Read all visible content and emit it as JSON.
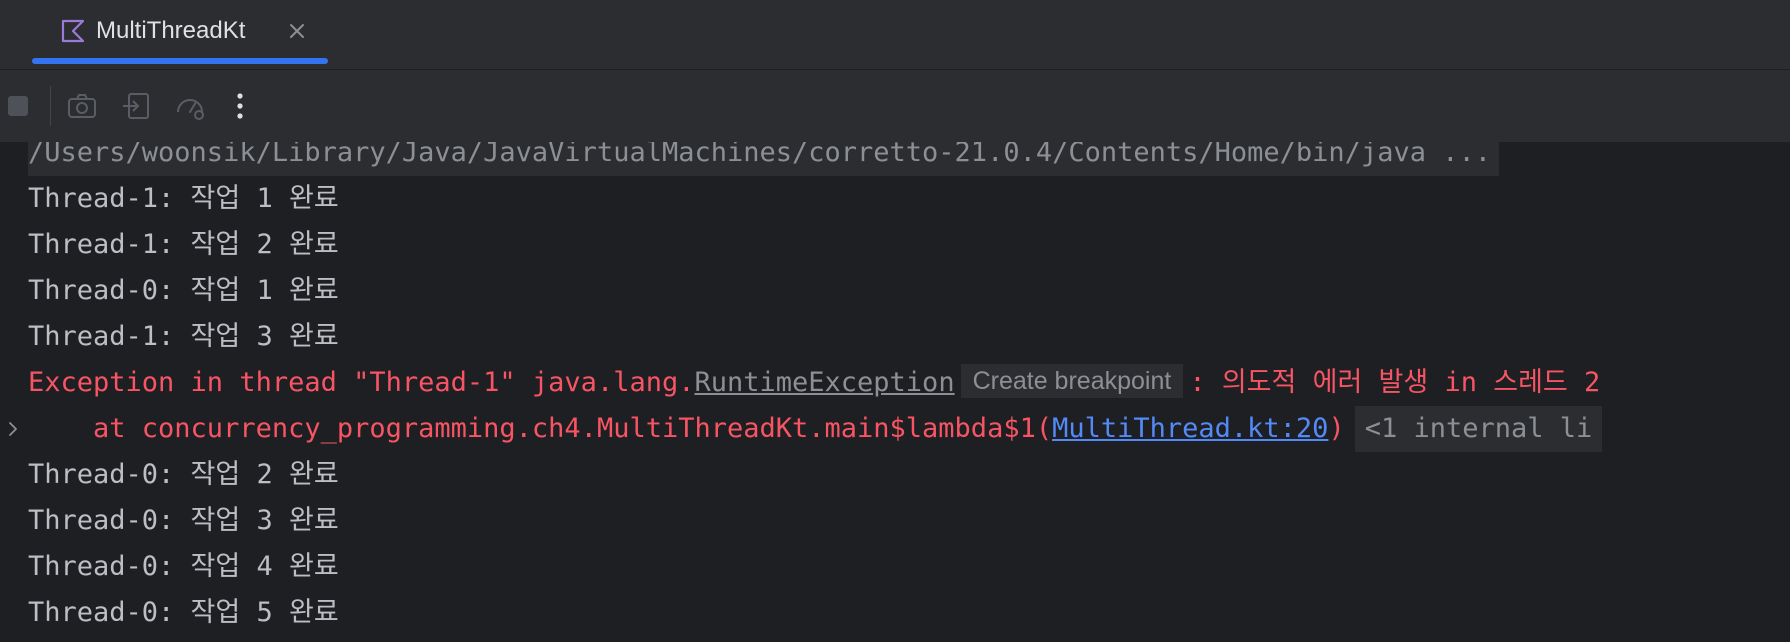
{
  "tab": {
    "label": "MultiThreadKt",
    "icon": "kotlin-icon",
    "accent": "#3574f0"
  },
  "toolbar": {
    "buttons": [
      "stop-icon",
      "camera-icon",
      "restore-layout-icon",
      "profiler-icon",
      "more-options-icon"
    ]
  },
  "console": {
    "command": "/Users/woonsik/Library/Java/JavaVirtualMachines/corretto-21.0.4/Contents/Home/bin/java ...",
    "lines_before": [
      "Thread-1: 작업 1 완료",
      "Thread-1: 작업 2 완료",
      "Thread-0: 작업 1 완료",
      "Thread-1: 작업 3 완료"
    ],
    "exception": {
      "prefix": "Exception in thread \"Thread-1\" java.lang.",
      "class_link": "RuntimeException",
      "breakpoint_hint": "Create breakpoint",
      "message": ": 의도적 에러 발생 in 스레드 2"
    },
    "stack": {
      "prefix": "    at concurrency_programming.ch4.MultiThreadKt.main$lambda$1(",
      "source_link": "MultiThread.kt:20",
      "suffix": ")",
      "internal": "<1 internal li"
    },
    "lines_after": [
      "Thread-0: 작업 2 완료",
      "Thread-0: 작업 3 완료",
      "Thread-0: 작업 4 완료",
      "Thread-0: 작업 5 완료"
    ],
    "colors": {
      "error": "#f75464",
      "link": "#548af7",
      "text": "#bcbec4",
      "background": "#1e1f22"
    }
  }
}
